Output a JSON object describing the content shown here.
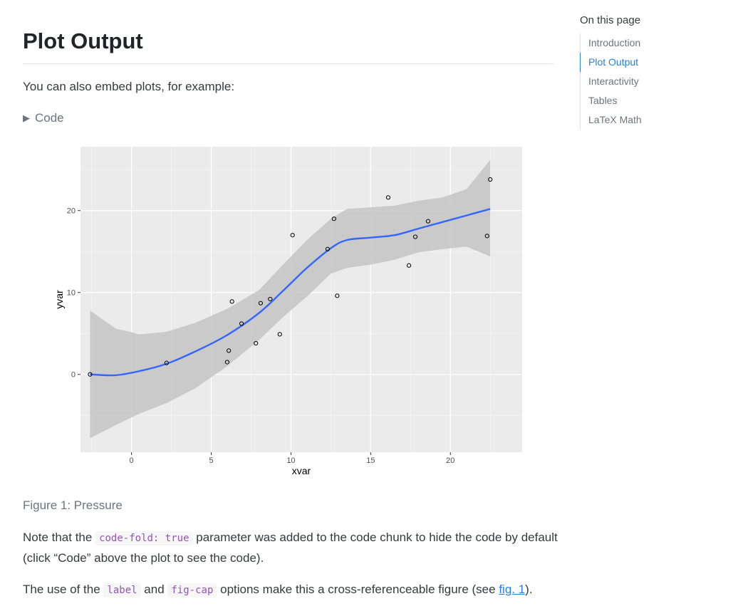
{
  "main": {
    "title": "Plot Output",
    "intro": "You can also embed plots, for example:",
    "code_toggle": {
      "icon": "triangle-right-icon",
      "label": "Code"
    },
    "figure_caption": "Figure 1: Pressure",
    "para1": {
      "before": "Note that the ",
      "code": "code-fold: true",
      "after": " parameter was added to the code chunk to hide the code by default (click “Code” above the plot to see the code)."
    },
    "para2": {
      "t1": "The use of the ",
      "code1": "label",
      "t2": " and ",
      "code2": "fig-cap",
      "t3": " options make this a cross-referenceable figure (see ",
      "link": "fig. 1",
      "t4": ")."
    }
  },
  "toc": {
    "title": "On this page",
    "items": [
      {
        "label": "Introduction",
        "active": false
      },
      {
        "label": "Plot Output",
        "active": true
      },
      {
        "label": "Interactivity",
        "active": false
      },
      {
        "label": "Tables",
        "active": false
      },
      {
        "label": "LaTeX Math",
        "active": false
      }
    ]
  },
  "colors": {
    "accent": "#2780e3",
    "smooth_line": "#3366ff",
    "panel": "#ebebeb",
    "ribbon": "#c4c4c4"
  },
  "chart_data": {
    "type": "scatter",
    "title": "",
    "xlabel": "xvar",
    "ylabel": "yvar",
    "xlim": [
      -3.2,
      24.5
    ],
    "ylim": [
      -9.5,
      27.8
    ],
    "x_ticks": [
      0,
      5,
      10,
      15,
      20
    ],
    "x_tick_labels": [
      "0",
      "5",
      "10",
      "15",
      "20"
    ],
    "y_ticks": [
      0,
      10,
      20
    ],
    "y_tick_labels": [
      "0",
      "10",
      "20"
    ],
    "grid": true,
    "legend": "none",
    "points": [
      {
        "x": -2.6,
        "y": 0.0
      },
      {
        "x": 2.2,
        "y": 1.4
      },
      {
        "x": 6.0,
        "y": 1.5
      },
      {
        "x": 6.1,
        "y": 2.9
      },
      {
        "x": 6.3,
        "y": 8.9
      },
      {
        "x": 6.9,
        "y": 6.2
      },
      {
        "x": 7.8,
        "y": 3.8
      },
      {
        "x": 8.1,
        "y": 8.7
      },
      {
        "x": 8.7,
        "y": 9.2
      },
      {
        "x": 9.3,
        "y": 4.9
      },
      {
        "x": 10.1,
        "y": 17.0
      },
      {
        "x": 12.3,
        "y": 15.3
      },
      {
        "x": 12.7,
        "y": 19.0
      },
      {
        "x": 12.9,
        "y": 9.6
      },
      {
        "x": 16.1,
        "y": 21.6
      },
      {
        "x": 17.4,
        "y": 13.3
      },
      {
        "x": 17.8,
        "y": 16.8
      },
      {
        "x": 18.6,
        "y": 18.7
      },
      {
        "x": 22.3,
        "y": 16.9
      },
      {
        "x": 22.5,
        "y": 23.8
      }
    ],
    "smooth": {
      "x": [
        -2.6,
        -1.0,
        0.5,
        2.2,
        4.0,
        6.0,
        8.0,
        9.5,
        11.0,
        12.5,
        13.5,
        15.0,
        16.5,
        18.0,
        19.5,
        21.0,
        22.5
      ],
      "y": [
        0.0,
        -0.1,
        0.4,
        1.3,
        2.8,
        4.8,
        7.5,
        10.2,
        13.0,
        15.4,
        16.4,
        16.7,
        17.0,
        17.8,
        18.6,
        19.4,
        20.2
      ],
      "lower": [
        -7.8,
        -6.2,
        -4.8,
        -3.5,
        -1.7,
        1.0,
        4.2,
        7.0,
        9.5,
        12.3,
        13.0,
        13.4,
        14.0,
        14.9,
        15.3,
        15.6,
        14.4
      ],
      "upper": [
        7.8,
        5.6,
        4.9,
        5.2,
        6.3,
        8.0,
        10.3,
        13.4,
        16.4,
        19.0,
        20.2,
        20.4,
        20.6,
        21.2,
        21.6,
        22.6,
        26.2
      ]
    }
  }
}
